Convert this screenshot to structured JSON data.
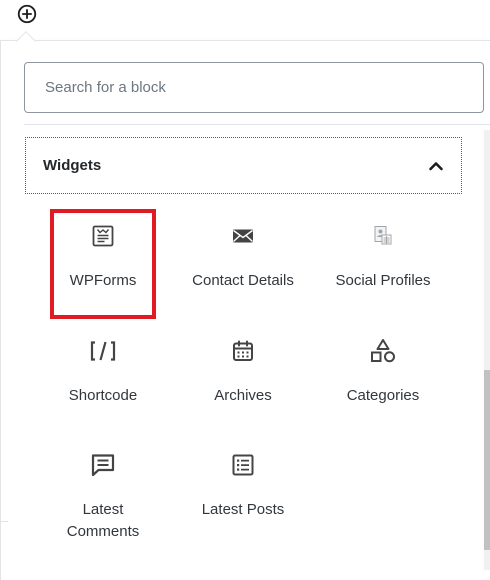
{
  "toolbar": {
    "add_block_icon": "plus-circle-icon"
  },
  "search": {
    "placeholder": "Search for a block",
    "value": ""
  },
  "panel": {
    "title": "Widgets",
    "expanded": true,
    "toggle_icon": "chevron-up-icon"
  },
  "blocks": [
    {
      "label": "WPForms",
      "icon": "wpforms-icon",
      "highlighted": true
    },
    {
      "label": "Contact Details",
      "icon": "envelope-icon",
      "highlighted": false
    },
    {
      "label": "Social Profiles",
      "icon": "social-profiles-icon",
      "highlighted": false
    },
    {
      "label": "Shortcode",
      "icon": "shortcode-icon",
      "highlighted": false
    },
    {
      "label": "Archives",
      "icon": "calendar-icon",
      "highlighted": false
    },
    {
      "label": "Categories",
      "icon": "shapes-icon",
      "highlighted": false
    },
    {
      "label": "Latest Comments",
      "icon": "comment-icon",
      "highlighted": false
    },
    {
      "label": "Latest Posts",
      "icon": "post-list-icon",
      "highlighted": false
    }
  ],
  "colors": {
    "highlight": "#e01b24",
    "icon": "#444444",
    "border": "#8d96a0"
  }
}
